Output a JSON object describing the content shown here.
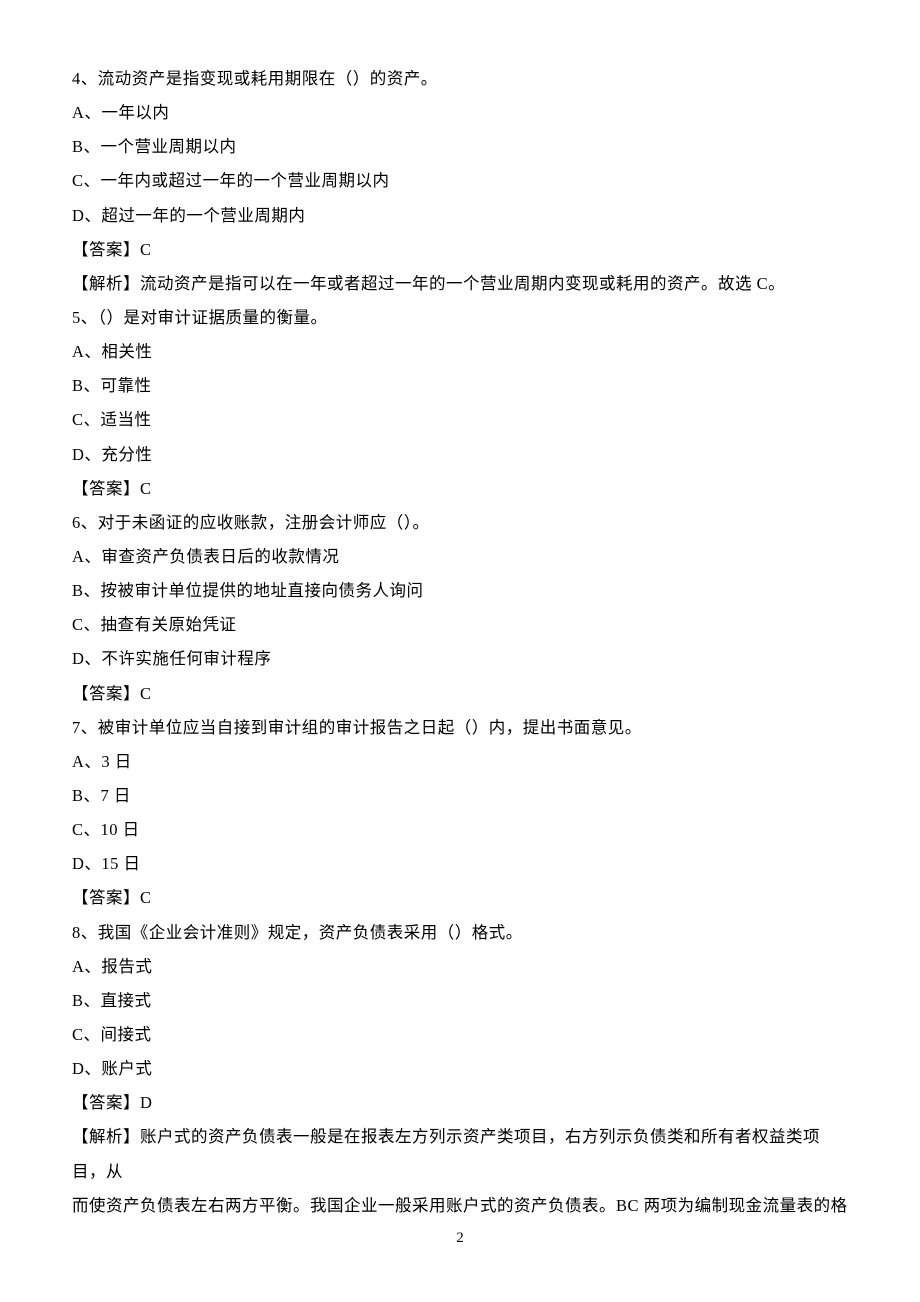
{
  "q4": {
    "stem": "4、流动资产是指变现或耗用期限在（）的资产。",
    "optA": "A、一年以内",
    "optB": "B、一个营业周期以内",
    "optC": "C、一年内或超过一年的一个营业周期以内",
    "optD": "D、超过一年的一个营业周期内",
    "answer": "【答案】C",
    "analysis": "【解析】流动资产是指可以在一年或者超过一年的一个营业周期内变现或耗用的资产。故选 C。"
  },
  "q5": {
    "stem": "5、（）是对审计证据质量的衡量。",
    "optA": "A、相关性",
    "optB": "B、可靠性",
    "optC": "C、适当性",
    "optD": "D、充分性",
    "answer": "【答案】C"
  },
  "q6": {
    "stem": "6、对于未函证的应收账款，注册会计师应（）。",
    "optA": "A、审查资产负债表日后的收款情况",
    "optB": "B、按被审计单位提供的地址直接向债务人询问",
    "optC": "C、抽查有关原始凭证",
    "optD": "D、不许实施任何审计程序",
    "answer": "【答案】C"
  },
  "q7": {
    "stem": "7、被审计单位应当自接到审计组的审计报告之日起（）内，提出书面意见。",
    "optA": "A、3 日",
    "optB": "B、7 日",
    "optC": "C、10 日",
    "optD": "D、15 日",
    "answer": "【答案】C"
  },
  "q8": {
    "stem": "8、我国《企业会计准则》规定，资产负债表采用（）格式。",
    "optA": "A、报告式",
    "optB": "B、直接式",
    "optC": "C、间接式",
    "optD": "D、账户式",
    "answer": "【答案】D",
    "analysis1": "【解析】账户式的资产负债表一般是在报表左方列示资产类项目，右方列示负债类和所有者权益类项目，从",
    "analysis2": "而使资产负债表左右两方平衡。我国企业一般采用账户式的资产负债表。BC 两项为编制现金流量表的格"
  },
  "pageNumber": "2"
}
